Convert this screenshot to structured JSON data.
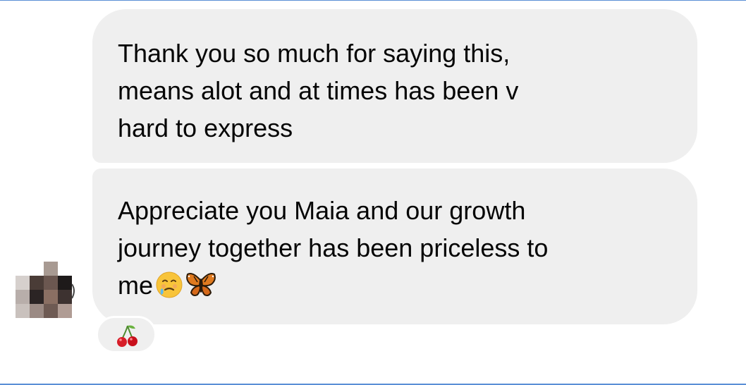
{
  "conversation": {
    "messages": [
      {
        "text": "Thank you so much for saying this,\nmeans alot and at times has been v\nhard to express"
      },
      {
        "text": "Appreciate you Maia and our growth\njourney together has been priceless to\nme",
        "trailing_emojis": [
          "smiling-face-with-tear-emoji",
          "butterfly-emoji"
        ]
      }
    ],
    "reaction": {
      "emoji": "cherries-emoji"
    },
    "avatar": {
      "style": "pixelated"
    }
  }
}
